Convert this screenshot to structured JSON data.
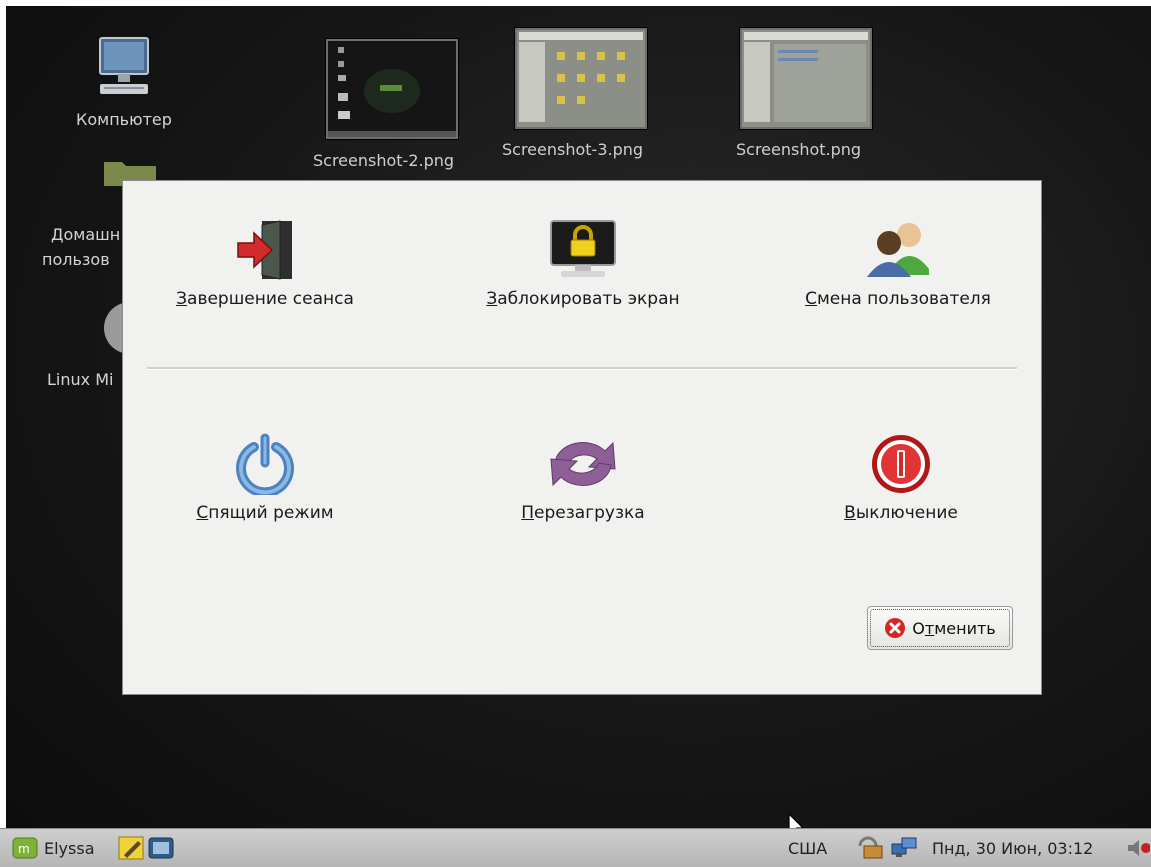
{
  "desktop": {
    "icons": [
      {
        "label": "Компьютер",
        "icon": "computer-icon"
      },
      {
        "label": "Домашн",
        "label2": "пользов",
        "icon": "home-folder-icon"
      },
      {
        "label": "Linux Mi",
        "icon": "linux-mint-icon"
      }
    ],
    "thumbnails": [
      {
        "label": "Screenshot-2.png"
      },
      {
        "label": "Screenshot-3.png"
      },
      {
        "label": "Screenshot.png"
      }
    ]
  },
  "dialog": {
    "actions": [
      {
        "mnemonic": "З",
        "rest": "авершение сеанса",
        "icon": "logout-icon"
      },
      {
        "mnemonic": "З",
        "rest": "аблокировать экран",
        "icon": "lock-screen-icon"
      },
      {
        "mnemonic": "С",
        "rest": "мена пользователя",
        "icon": "switch-user-icon"
      },
      {
        "mnemonic": "С",
        "rest": "пящий режим",
        "icon": "suspend-icon"
      },
      {
        "mnemonic": "П",
        "rest": "ерезагрузка",
        "icon": "restart-icon"
      },
      {
        "mnemonic": "В",
        "rest": "ыключение",
        "icon": "shutdown-icon"
      }
    ],
    "cancel": {
      "prefix": "О",
      "mnemonic": "т",
      "rest": "менить",
      "icon": "cancel-icon"
    }
  },
  "panel": {
    "user": "Elyssa",
    "keyboard_layout": "США",
    "clock": "Пнд, 30 Июн, 03:12",
    "colors": {
      "background": "#c4c4c4",
      "mint_green": "#7fb23a"
    }
  }
}
